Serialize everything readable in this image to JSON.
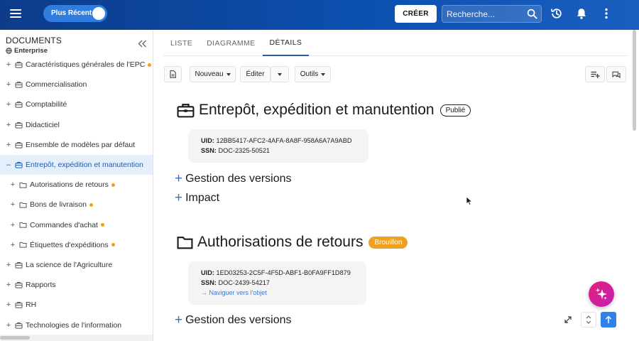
{
  "topbar": {
    "menu_icon": "hamburger-icon",
    "recent_toggle_label": "Plus Récent",
    "create_label": "CRÉER",
    "search_placeholder": "Recherche...",
    "icons": [
      "search-icon",
      "history-icon",
      "bell-icon",
      "more-vertical-icon"
    ],
    "color": "#0b4fae"
  },
  "sidebar": {
    "title": "DOCUMENTS",
    "subtitle": "Enterprise",
    "items": [
      {
        "label": "Caractéristiques générales de l'EPC",
        "level": 0,
        "icon": "briefcase-icon",
        "dot": true,
        "expander": "+"
      },
      {
        "label": "Commercialisation",
        "level": 0,
        "icon": "briefcase-icon",
        "dot": false,
        "expander": "+"
      },
      {
        "label": "Comptabilité",
        "level": 0,
        "icon": "briefcase-icon",
        "dot": false,
        "expander": "+"
      },
      {
        "label": "Didacticiel",
        "level": 0,
        "icon": "briefcase-icon",
        "dot": false,
        "expander": "+"
      },
      {
        "label": "Ensemble de modèles par défaut",
        "level": 0,
        "icon": "briefcase-icon",
        "dot": false,
        "expander": "+"
      },
      {
        "label": "Entrepôt, expédition et manutention",
        "level": 0,
        "icon": "briefcase-icon",
        "dot": false,
        "expander": "–",
        "active": true
      },
      {
        "label": "Autorisations de retours",
        "level": 1,
        "icon": "folder-icon",
        "dot": true,
        "expander": "+"
      },
      {
        "label": "Bons de livraison",
        "level": 1,
        "icon": "folder-icon",
        "dot": true,
        "expander": "+"
      },
      {
        "label": "Commandes d'achat",
        "level": 1,
        "icon": "folder-icon",
        "dot": true,
        "expander": "+"
      },
      {
        "label": "Étiquettes d'expéditions",
        "level": 1,
        "icon": "folder-icon",
        "dot": true,
        "expander": "+"
      },
      {
        "label": "La science de l'Agriculture",
        "level": 0,
        "icon": "briefcase-icon",
        "dot": false,
        "expander": "+"
      },
      {
        "label": "Rapports",
        "level": 0,
        "icon": "briefcase-icon",
        "dot": false,
        "expander": "+"
      },
      {
        "label": "RH",
        "level": 0,
        "icon": "briefcase-icon",
        "dot": false,
        "expander": "+"
      },
      {
        "label": "Technologies de l'information",
        "level": 0,
        "icon": "briefcase-icon",
        "dot": false,
        "expander": "+"
      }
    ],
    "dot_color": "#f2a01e",
    "active_color": "#e4effb"
  },
  "tabs": [
    {
      "label": "LISTE",
      "active": false
    },
    {
      "label": "DIAGRAMME",
      "active": false
    },
    {
      "label": "DÉTAILS",
      "active": true
    }
  ],
  "toolbar": {
    "new_label": "Nouveau",
    "edit_label": "Éditer",
    "tools_label": "Outils"
  },
  "objects": [
    {
      "title": "Entrepôt, expédition et manutention",
      "icon": "briefcase-icon",
      "status": "Publié",
      "uid_label": "UID:",
      "uid": "12BB5417-AFC2-4AFA-8A8F-958A6A7A9ABD",
      "ssn_label": "SSN:",
      "ssn": "DOC-2325-50521",
      "sections": [
        "Gestion des versions",
        "Impact"
      ]
    },
    {
      "title": "Authorisations de retours",
      "icon": "folder-icon",
      "status": "Brouillon",
      "uid_label": "UID:",
      "uid": "1ED03253-2C5F-4F5D-ABF1-B0FA9FF1D879",
      "ssn_label": "SSN:",
      "ssn": "DOC-2439-54217",
      "link": "→ Naviguer vers l'objet",
      "sections": [
        "Gestion des versions"
      ]
    }
  ],
  "status_colors": {
    "draft": "#f0a020",
    "published": "#ffffff"
  },
  "fab_icon": "sparkles-icon",
  "bottom_buttons": [
    "expand-icon",
    "chevron-up-down-icon",
    "arrow-up-icon"
  ]
}
